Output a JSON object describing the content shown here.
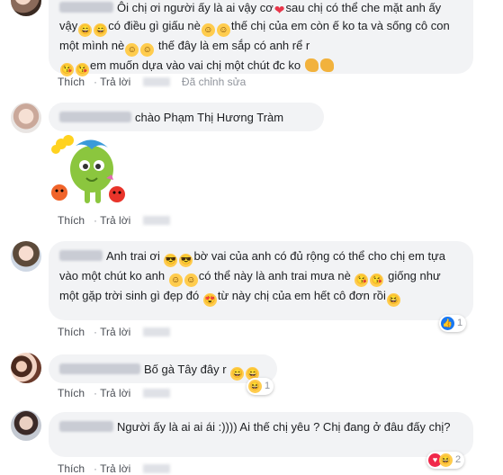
{
  "comments": [
    {
      "text_parts": [
        "Ôi chị ơi người ấy là ai vậy cơ",
        "sau chị có thể che mặt anh ấy vậy",
        "có điều gì giấu nè",
        "thế chị của em còn ế ko ta và sống cô con một mình nè",
        "thế đây là em sắp có anh rể r",
        "em muốn dựa vào vai chị một chút đc ko"
      ],
      "actions": {
        "like": "Thích",
        "reply": "Trả lời",
        "edited": "Đã chỉnh sửa"
      }
    },
    {
      "text": "chào Phạm Thị Hương Tràm",
      "actions": {
        "like": "Thích",
        "reply": "Trả lời"
      }
    },
    {
      "text_parts": [
        "Anh trai ơi",
        "bờ vai của anh có đủ rộng có thể cho chị em tựa vào một chút ko anh",
        "có thể này là anh trai mưa nè",
        "giống như một gặp trời sinh gì đẹp đó",
        "từ này chị của em hết cô đơn rồi"
      ],
      "actions": {
        "like": "Thích",
        "reply": "Trả lời"
      },
      "reaction_count": "1"
    },
    {
      "text": "Bố gà Tây đây r",
      "actions": {
        "like": "Thích",
        "reply": "Trả lời"
      },
      "reaction_count": "1"
    },
    {
      "text": "Người ấy là ai ai ái :)))) Ai thế chị yêu ? Chị đang ở đâu đấy chị?",
      "actions": {
        "like": "Thích",
        "reply": "Trả lời"
      },
      "reaction_count": "2"
    }
  ],
  "colors": {
    "bubble": "#f2f3f5",
    "meta": "#90949c",
    "like": "#1877f2",
    "love": "#f0284a",
    "haha": "#ffcc4d"
  }
}
